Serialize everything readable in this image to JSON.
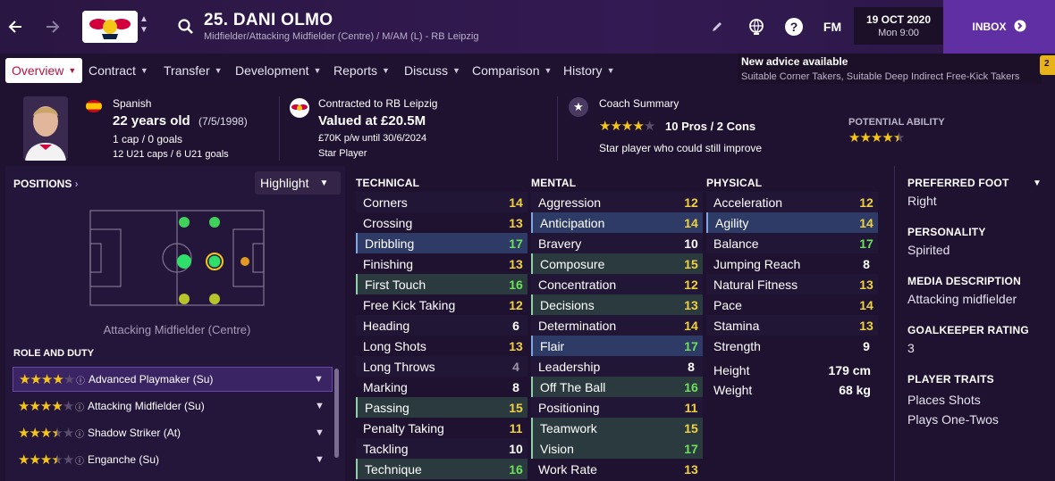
{
  "header": {
    "title": "25. DANI OLMO",
    "subtitle": "Midfielder/Attacking Midfielder (Centre) / M/AM (L) - RB Leipzig",
    "date": "19 OCT 2020",
    "time": "Mon 9:00",
    "fm_label": "FM",
    "inbox_label": "INBOX"
  },
  "tabs": [
    {
      "label": "Overview"
    },
    {
      "label": "Contract"
    },
    {
      "label": "Transfer"
    },
    {
      "label": "Development"
    },
    {
      "label": "Reports"
    },
    {
      "label": "Discuss"
    },
    {
      "label": "Comparison"
    },
    {
      "label": "History"
    }
  ],
  "advice": {
    "heading": "New advice available",
    "body": "Suitable Corner Takers, Suitable Deep Indirect Free-Kick Takers",
    "badge": "2"
  },
  "info": {
    "nationality": "Spanish",
    "age": "22 years old",
    "dob": "(7/5/1998)",
    "caps": "1 cap / 0 goals",
    "u21": "12 U21 caps / 6 U21 goals",
    "contract_label": "Contracted to RB Leipzig",
    "value": "Valued at £20.5M",
    "wage": "£70K p/w until 30/6/2024",
    "status": "Star Player",
    "coach_label": "Coach Summary",
    "coach_rating": 4,
    "pros_cons": "10 Pros / 2 Cons",
    "coach_note": "Star player who could still improve",
    "potential_label": "POTENTIAL ABILITY",
    "potential_rating": 4.5
  },
  "positions": {
    "heading": "POSITIONS",
    "highlight_label": "Highlight",
    "position_name": "Attacking Midfielder (Centre)"
  },
  "roles": {
    "heading": "ROLE AND DUTY",
    "items": [
      {
        "name": "Advanced Playmaker (Su)",
        "stars": 4,
        "selected": true
      },
      {
        "name": "Attacking Midfielder (Su)",
        "stars": 4,
        "selected": false
      },
      {
        "name": "Shadow Striker (At)",
        "stars": 3.5,
        "selected": false
      },
      {
        "name": "Enganche (Su)",
        "stars": 3.5,
        "selected": false
      }
    ]
  },
  "technical": {
    "heading": "TECHNICAL",
    "items": [
      {
        "name": "Corners",
        "value": "14"
      },
      {
        "name": "Crossing",
        "value": "13"
      },
      {
        "name": "Dribbling",
        "value": "17"
      },
      {
        "name": "Finishing",
        "value": "13"
      },
      {
        "name": "First Touch",
        "value": "16"
      },
      {
        "name": "Free Kick Taking",
        "value": "12"
      },
      {
        "name": "Heading",
        "value": "6"
      },
      {
        "name": "Long Shots",
        "value": "13"
      },
      {
        "name": "Long Throws",
        "value": "4"
      },
      {
        "name": "Marking",
        "value": "8"
      },
      {
        "name": "Passing",
        "value": "15"
      },
      {
        "name": "Penalty Taking",
        "value": "11"
      },
      {
        "name": "Tackling",
        "value": "10"
      },
      {
        "name": "Technique",
        "value": "16"
      }
    ]
  },
  "mental": {
    "heading": "MENTAL",
    "items": [
      {
        "name": "Aggression",
        "value": "12"
      },
      {
        "name": "Anticipation",
        "value": "14"
      },
      {
        "name": "Bravery",
        "value": "10"
      },
      {
        "name": "Composure",
        "value": "15"
      },
      {
        "name": "Concentration",
        "value": "12"
      },
      {
        "name": "Decisions",
        "value": "13"
      },
      {
        "name": "Determination",
        "value": "14"
      },
      {
        "name": "Flair",
        "value": "17"
      },
      {
        "name": "Leadership",
        "value": "8"
      },
      {
        "name": "Off The Ball",
        "value": "16"
      },
      {
        "name": "Positioning",
        "value": "11"
      },
      {
        "name": "Teamwork",
        "value": "15"
      },
      {
        "name": "Vision",
        "value": "17"
      },
      {
        "name": "Work Rate",
        "value": "13"
      }
    ]
  },
  "physical": {
    "heading": "PHYSICAL",
    "items": [
      {
        "name": "Acceleration",
        "value": "12"
      },
      {
        "name": "Agility",
        "value": "14"
      },
      {
        "name": "Balance",
        "value": "17"
      },
      {
        "name": "Jumping Reach",
        "value": "8"
      },
      {
        "name": "Natural Fitness",
        "value": "13"
      },
      {
        "name": "Pace",
        "value": "14"
      },
      {
        "name": "Stamina",
        "value": "13"
      },
      {
        "name": "Strength",
        "value": "9"
      },
      {
        "name": "Height",
        "value": "179 cm"
      },
      {
        "name": "Weight",
        "value": "68 kg"
      }
    ]
  },
  "profile": {
    "foot_h": "PREFERRED FOOT",
    "foot": "Right",
    "personality_h": "PERSONALITY",
    "personality": "Spirited",
    "media_h": "MEDIA DESCRIPTION",
    "media": "Attacking midfielder",
    "gk_h": "GOALKEEPER RATING",
    "gk": "3",
    "traits_h": "PLAYER TRAITS",
    "trait1": "Places Shots",
    "trait2": "Plays One-Twos"
  },
  "colors": {
    "accent": "#5f2fa3",
    "tab_active_text": "#b3153e",
    "value_yellow": "#f0d140",
    "value_green": "#6ee05a",
    "star": "#f5c518"
  }
}
